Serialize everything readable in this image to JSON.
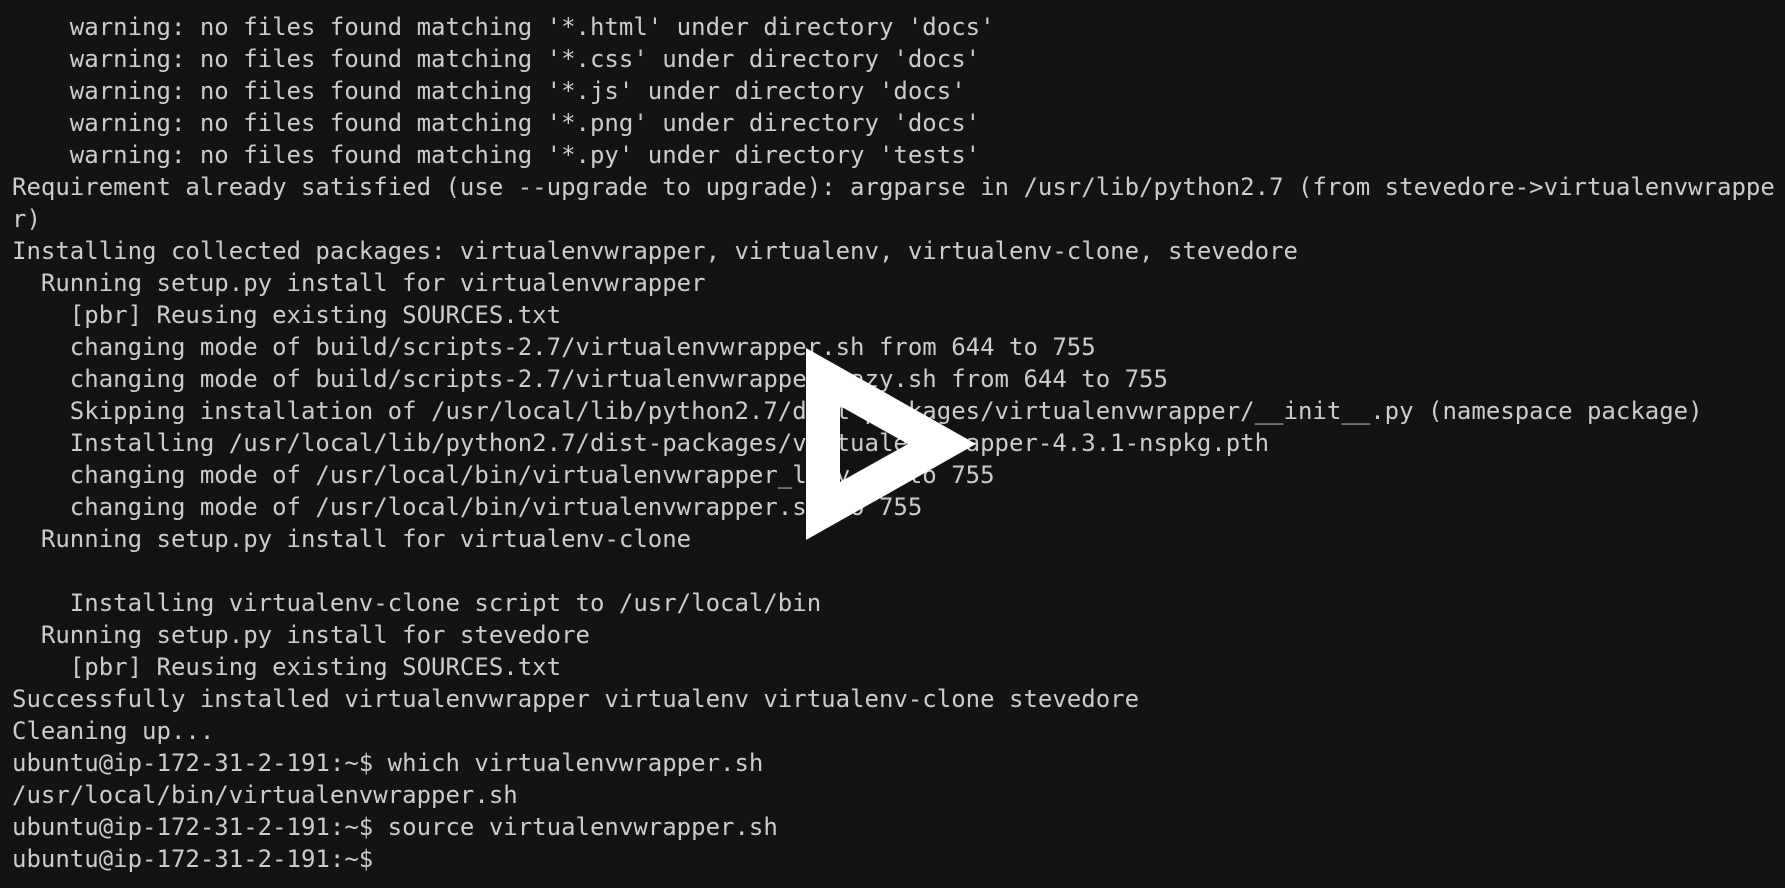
{
  "terminal": {
    "lines": [
      "    warning: no files found matching '*.html' under directory 'docs'",
      "    warning: no files found matching '*.css' under directory 'docs'",
      "    warning: no files found matching '*.js' under directory 'docs'",
      "    warning: no files found matching '*.png' under directory 'docs'",
      "    warning: no files found matching '*.py' under directory 'tests'",
      "Requirement already satisfied (use --upgrade to upgrade): argparse in /usr/lib/python2.7 (from stevedore->virtualenvwrappe",
      "r)",
      "Installing collected packages: virtualenvwrapper, virtualenv, virtualenv-clone, stevedore",
      "  Running setup.py install for virtualenvwrapper",
      "    [pbr] Reusing existing SOURCES.txt",
      "    changing mode of build/scripts-2.7/virtualenvwrapper.sh from 644 to 755",
      "    changing mode of build/scripts-2.7/virtualenvwrapper_lazy.sh from 644 to 755",
      "    Skipping installation of /usr/local/lib/python2.7/dist-packages/virtualenvwrapper/__init__.py (namespace package)",
      "    Installing /usr/local/lib/python2.7/dist-packages/virtualenvwrapper-4.3.1-nspkg.pth",
      "    changing mode of /usr/local/bin/virtualenvwrapper_lazy.sh to 755",
      "    changing mode of /usr/local/bin/virtualenvwrapper.sh to 755",
      "  Running setup.py install for virtualenv-clone",
      "",
      "    Installing virtualenv-clone script to /usr/local/bin",
      "  Running setup.py install for stevedore",
      "    [pbr] Reusing existing SOURCES.txt",
      "Successfully installed virtualenvwrapper virtualenv virtualenv-clone stevedore",
      "Cleaning up...",
      "ubuntu@ip-172-31-2-191:~$ which virtualenvwrapper.sh",
      "/usr/local/bin/virtualenvwrapper.sh",
      "ubuntu@ip-172-31-2-191:~$ source virtualenvwrapper.sh",
      "ubuntu@ip-172-31-2-191:~$ "
    ]
  },
  "overlay": {
    "icon": "play-icon",
    "color": "#ffffff"
  },
  "colors": {
    "background": "#121314",
    "text": "#cccccc"
  }
}
